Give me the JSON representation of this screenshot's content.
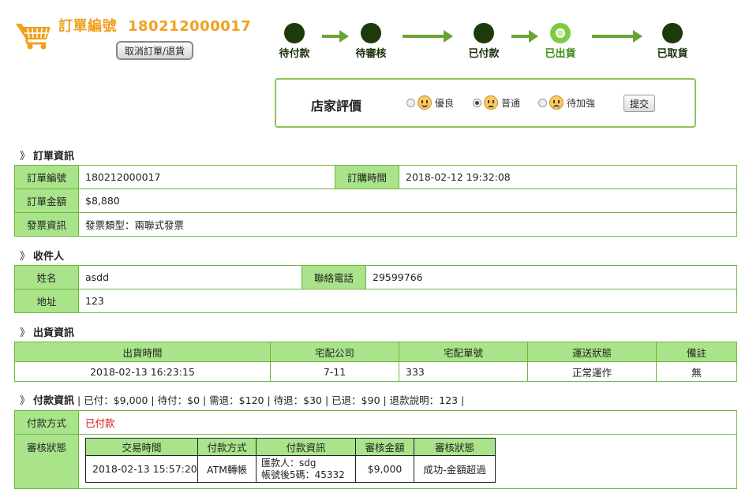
{
  "header": {
    "title": "訂單編號",
    "order_number": "180212000017",
    "cancel_label": "取消訂單/退貨"
  },
  "progress": {
    "steps": [
      {
        "label": "待付款",
        "state": "done"
      },
      {
        "label": "待審核",
        "state": "done"
      },
      {
        "label": "已付款",
        "state": "done"
      },
      {
        "label": "已出貨",
        "state": "current"
      },
      {
        "label": "已取貨",
        "state": "pending"
      }
    ]
  },
  "rating": {
    "title": "店家評價",
    "options": [
      {
        "label": "優良",
        "face": "smile",
        "selected": false
      },
      {
        "label": "普通",
        "face": "neutral",
        "selected": true
      },
      {
        "label": "待加強",
        "face": "sad",
        "selected": false
      }
    ],
    "submit_label": "提交"
  },
  "order_info": {
    "heading": "訂單資訊",
    "order_no_label": "訂單編號",
    "order_no": "180212000017",
    "order_time_label": "訂購時間",
    "order_time": "2018-02-12 19:32:08",
    "amount_label": "訂單金額",
    "amount": "$8,880",
    "invoice_label": "發票資訊",
    "invoice": "發票類型：兩聯式發票"
  },
  "recipient": {
    "heading": "收件人",
    "name_label": "姓名",
    "name": "asdd",
    "phone_label": "聯絡電話",
    "phone": "29599766",
    "address_label": "地址",
    "address": "123"
  },
  "shipping": {
    "heading": "出貨資訊",
    "columns": [
      "出貨時間",
      "宅配公司",
      "宅配單號",
      "運送狀態",
      "備註"
    ],
    "row": [
      "2018-02-13 16:23:15",
      "7-11",
      "333",
      "正常運作",
      "無"
    ]
  },
  "payment": {
    "heading": "付款資訊",
    "summary": "|  已付：$9,000  |  待付：$0  |  需退：$120  |  待退：$30  |  已退：$90  |  退款說明：123  |",
    "method_label": "付款方式",
    "method_value": "已付款",
    "review_label": "審核狀態",
    "review_columns": [
      "交易時間",
      "付款方式",
      "付款資訊",
      "審核金額",
      "審核狀態"
    ],
    "review_row": {
      "time": "2018-02-13 15:57:20",
      "method": "ATM轉帳",
      "info_line1": "匯款人：sdg",
      "info_line2": "帳號後5碼：45332",
      "amount": "$9,000",
      "status": "成功-金額超過"
    }
  },
  "colors": {
    "accent_orange": "#f0a020",
    "table_header_green": "#a9e48a",
    "border_green": "#6fb53b",
    "step_dark": "#1d3a0a",
    "paid_red": "#dd1111"
  }
}
